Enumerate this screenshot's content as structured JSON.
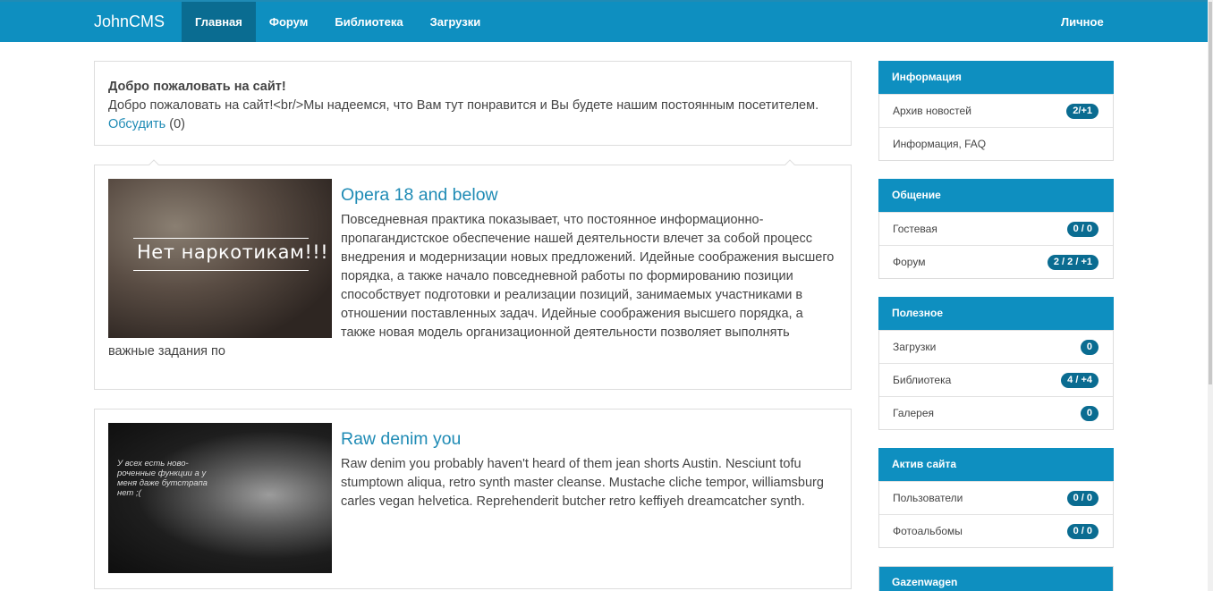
{
  "navbar": {
    "brand": "JohnCMS",
    "items": [
      {
        "label": "Главная",
        "active": true
      },
      {
        "label": "Форум",
        "active": false
      },
      {
        "label": "Библиотека",
        "active": false
      },
      {
        "label": "Загрузки",
        "active": false
      }
    ],
    "right_label": "Личное"
  },
  "welcome": {
    "title": "Добро пожаловать на сайт!",
    "text": "Добро пожаловать на сайт!<br/>Мы надеемся, что Вам тут понравится и Вы будете нашим постоянным посетителем.",
    "discuss_link": "Обсудить",
    "discuss_count": "(0)"
  },
  "articles": [
    {
      "title": "Opera 18 and below",
      "image_caption": "Нет наркотикам!!!",
      "text": "Повседневная практика показывает, что постоянное информационно-пропагандистское обеспечение нашей деятельности влечет за собой процесс внедрения и модернизации новых предложений. Идейные соображения высшего порядка, а также начало повседневной работы по формированию позиции способствует подготовки и реализации позиций, занимаемых участниками в отношении поставленных задач. Идейные соображения высшего порядка, а также новая модель организационной деятельности позволяет выполнять важные задания по"
    },
    {
      "title": "Raw denim you",
      "image_caption": "У всех есть ново-роченные функции а у меня даже бутстрапа нет ;(",
      "text": "Raw denim you probably haven't heard of them jean shorts Austin. Nesciunt tofu stumptown aliqua, retro synth master cleanse. Mustache cliche tempor, williamsburg carles vegan helvetica. Reprehenderit butcher retro keffiyeh dreamcatcher synth."
    }
  ],
  "sidebar": [
    {
      "title": "Информация",
      "rows": [
        {
          "label": "Архив новостей",
          "badge": "2/+1"
        },
        {
          "label": "Информация, FAQ",
          "badge": ""
        }
      ]
    },
    {
      "title": "Общение",
      "rows": [
        {
          "label": "Гостевая",
          "badge": "0 / 0"
        },
        {
          "label": "Форум",
          "badge": "2 / 2 / +1"
        }
      ]
    },
    {
      "title": "Полезное",
      "rows": [
        {
          "label": "Загрузки",
          "badge": "0"
        },
        {
          "label": "Библиотека",
          "badge": "4 / +4"
        },
        {
          "label": "Галерея",
          "badge": "0"
        }
      ]
    },
    {
      "title": "Актив сайта",
      "rows": [
        {
          "label": "Пользователи",
          "badge": "0 / 0"
        },
        {
          "label": "Фотоальбомы",
          "badge": "0 / 0"
        }
      ]
    },
    {
      "title": "Gazenwagen",
      "rows": []
    }
  ],
  "colors": {
    "navbar": "#0e8fc0",
    "nav_active": "#0a6c91",
    "link": "#1f8bb5",
    "badge": "#0a6c91"
  }
}
